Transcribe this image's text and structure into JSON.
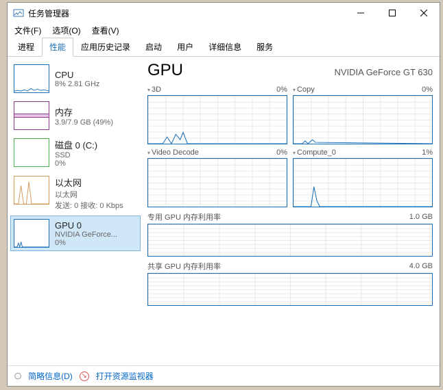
{
  "window": {
    "title": "任务管理器"
  },
  "menu": {
    "file": "文件(F)",
    "options": "选项(O)",
    "view": "查看(V)"
  },
  "tabs": [
    "进程",
    "性能",
    "应用历史记录",
    "启动",
    "用户",
    "详细信息",
    "服务"
  ],
  "sidebar": {
    "items": [
      {
        "name": "CPU",
        "sub": "8% 2.81 GHz"
      },
      {
        "name": "内存",
        "sub": "3.9/7.9 GB (49%)"
      },
      {
        "name": "磁盘 0 (C:)",
        "sub1": "SSD",
        "sub2": "0%"
      },
      {
        "name": "以太网",
        "sub1": "以太网",
        "sub2": "发送: 0 接收: 0 Kbps"
      },
      {
        "name": "GPU 0",
        "sub1": "NVIDIA GeForce...",
        "sub2": "0%"
      }
    ]
  },
  "main": {
    "title": "GPU",
    "device": "NVIDIA GeForce GT 630",
    "charts": [
      {
        "label": "3D",
        "pct": "0%"
      },
      {
        "label": "Copy",
        "pct": "0%"
      },
      {
        "label": "Video Decode",
        "pct": "0%"
      },
      {
        "label": "Compute_0",
        "pct": "1%"
      }
    ],
    "mem1": {
      "label": "专用 GPU 内存利用率",
      "val": "1.0 GB"
    },
    "mem2": {
      "label": "共享 GPU 内存利用率",
      "val": "4.0 GB"
    }
  },
  "footer": {
    "brief": "简略信息(D)",
    "monitor": "打开资源监视器"
  },
  "chart_data": {
    "type": "line",
    "title": "GPU utilization",
    "series": [
      {
        "name": "3D",
        "y_pct_recent": [
          0,
          0,
          0,
          0,
          5,
          0,
          8,
          12,
          4,
          0
        ]
      },
      {
        "name": "Copy",
        "y_pct_recent": [
          0,
          0,
          0,
          0,
          0,
          0,
          0,
          0,
          2,
          4
        ]
      },
      {
        "name": "Video Decode",
        "y_pct_recent": [
          0,
          0,
          0,
          0,
          0,
          0,
          0,
          0,
          0,
          0
        ]
      },
      {
        "name": "Compute_0",
        "y_pct_recent": [
          0,
          0,
          0,
          0,
          18,
          6,
          0,
          0,
          0,
          0
        ]
      }
    ],
    "ylim": [
      0,
      100
    ],
    "ylabel": "%"
  }
}
